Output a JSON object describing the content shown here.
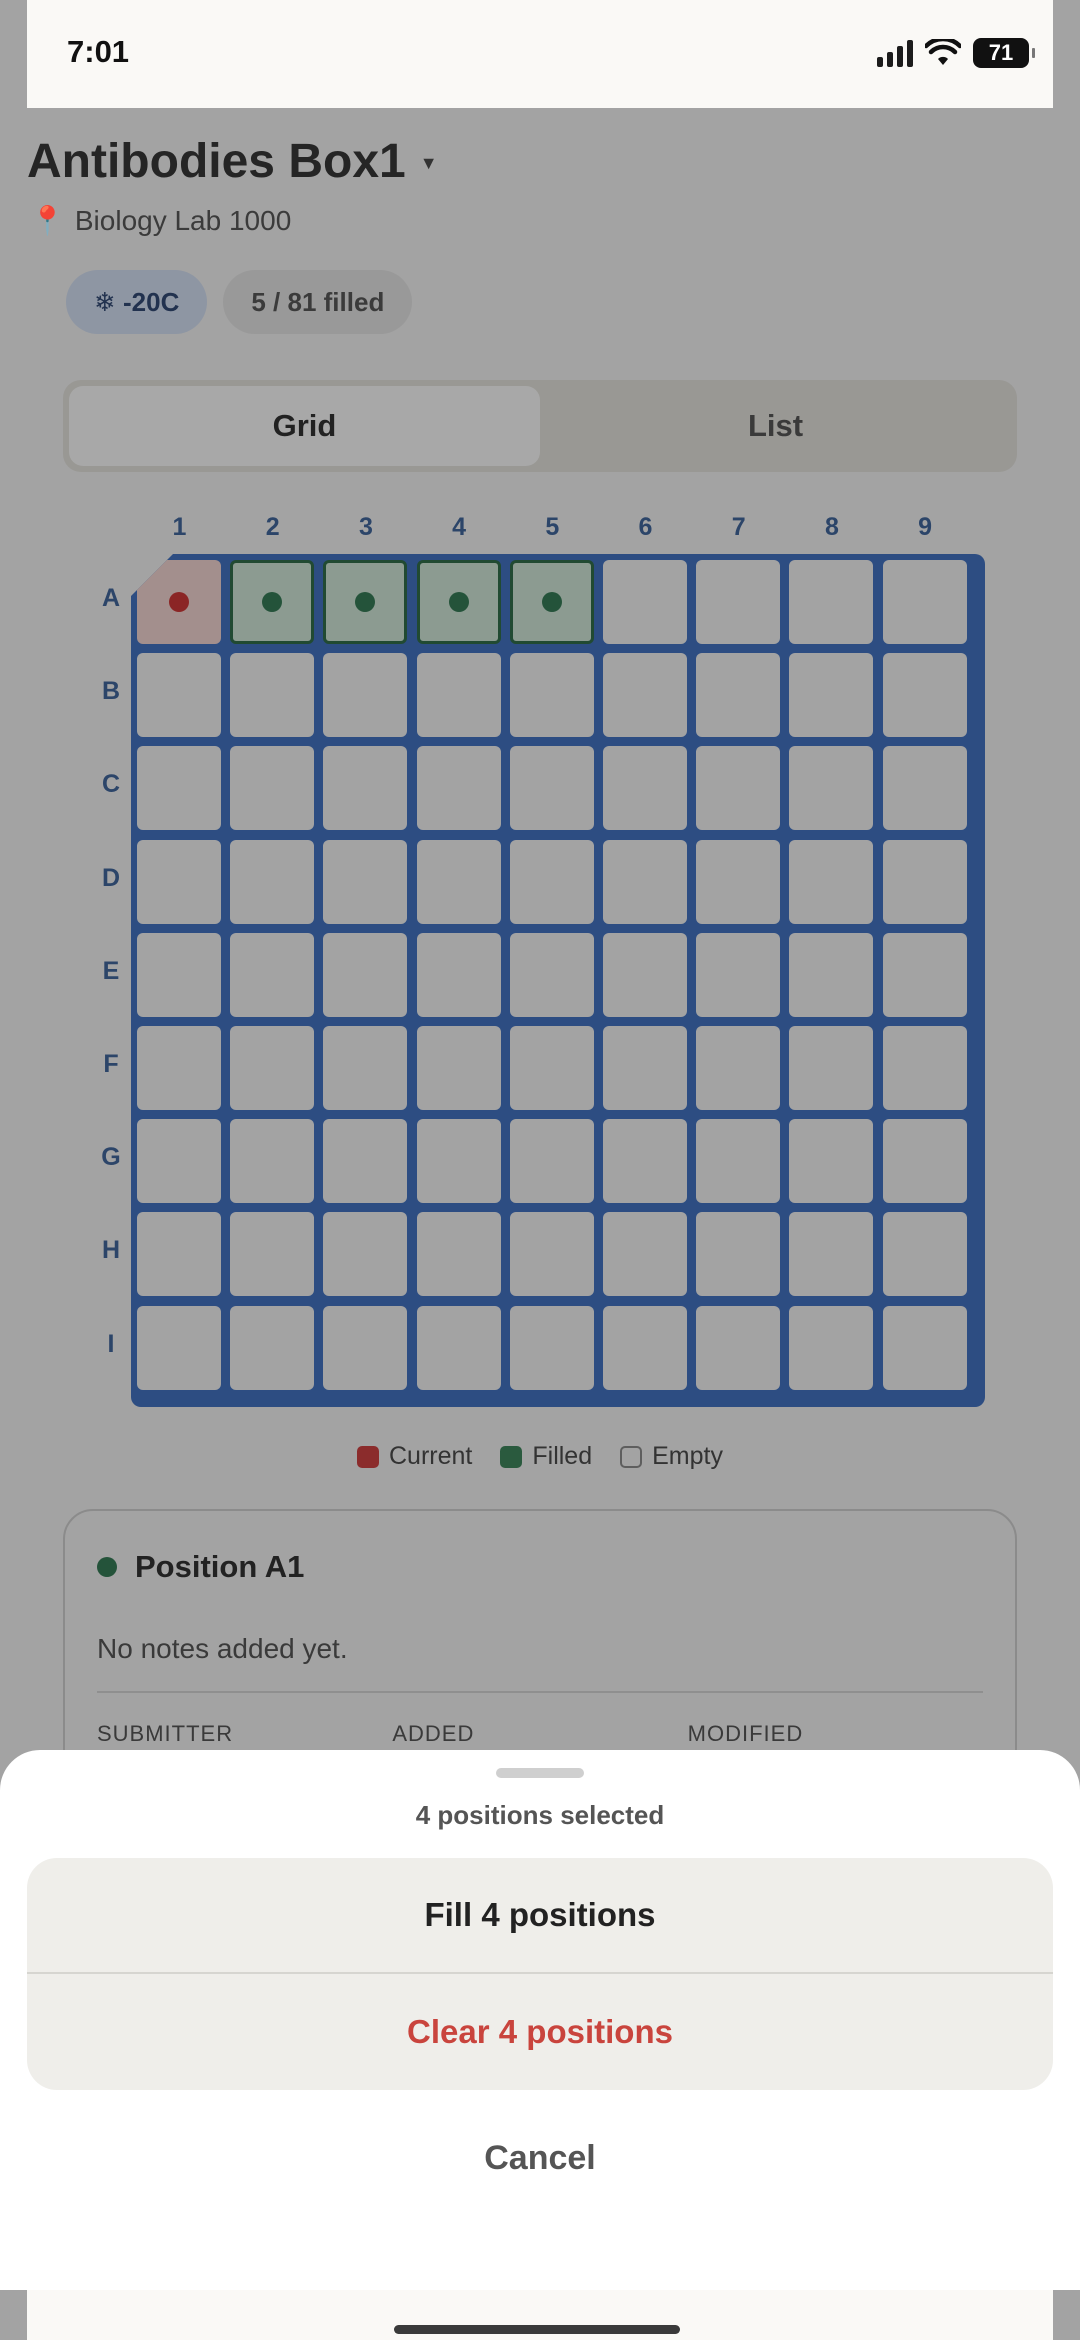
{
  "status_bar": {
    "time": "7:01",
    "battery": "71"
  },
  "header": {
    "title": "Antibodies Box1",
    "location": "Biology Lab 1000"
  },
  "chips": {
    "temperature": "❄ -20C",
    "fill_count": "5 / 81 filled"
  },
  "view_toggle": {
    "grid": "Grid",
    "list": "List",
    "selected": "Grid"
  },
  "grid": {
    "columns": [
      "1",
      "2",
      "3",
      "4",
      "5",
      "6",
      "7",
      "8",
      "9"
    ],
    "rows": [
      "A",
      "B",
      "C",
      "D",
      "E",
      "F",
      "G",
      "H",
      "I"
    ],
    "current": "A1",
    "filled": [
      "A2",
      "A3",
      "A4",
      "A5"
    ]
  },
  "legend": {
    "current": "Current",
    "filled": "Filled",
    "empty": "Empty"
  },
  "detail": {
    "title": "Position A1",
    "notes": "No notes added yet.",
    "submitter_label": "SUBMITTER",
    "added_label": "ADDED",
    "modified_label": "MODIFIED"
  },
  "sheet": {
    "title": "4 positions selected",
    "fill_label": "Fill 4 positions",
    "clear_label": "Clear 4 positions",
    "cancel_label": "Cancel"
  },
  "colors": {
    "grid_frame": "#2d4d82",
    "current": "#8b2c2c",
    "filled": "#2a5a3e",
    "destructive": "#c9443d"
  }
}
